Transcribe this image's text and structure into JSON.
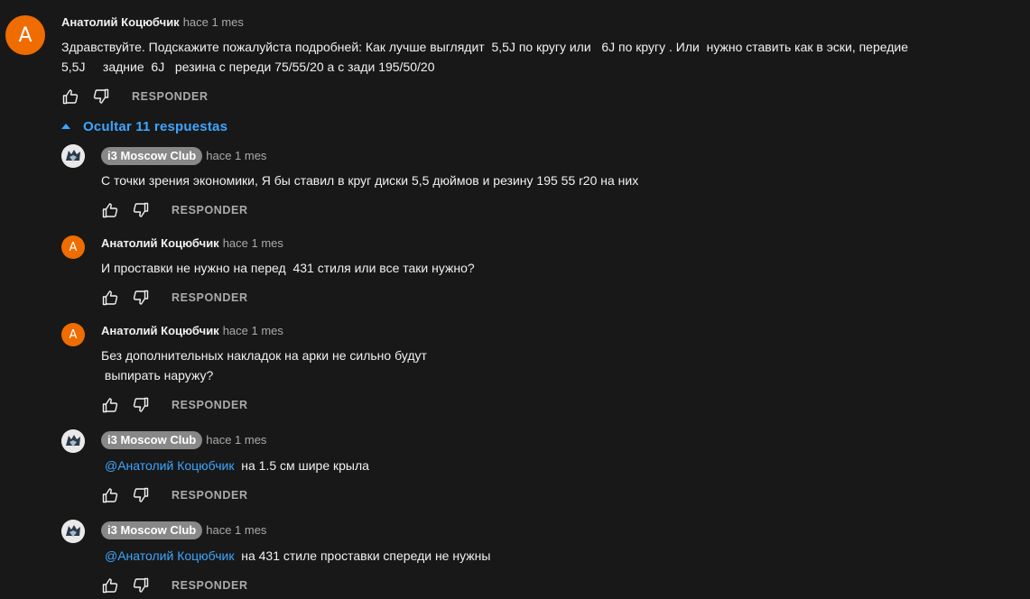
{
  "main_comment": {
    "avatar_letter": "A",
    "author": "Анатолий Коцюбчик",
    "time": "hace 1 mes",
    "text_line1": "Здравствуйте. Подскажите пожалуйста подробней: Как лучше выглядит  5,5J по кругу или   6J по кругу . Или  нужно ставить как в эски, передие",
    "text_line2": "5,5J     задние  6J   резина с переди 75/55/20 а с зади 195/50/20",
    "reply_label": "RESPONDER"
  },
  "replies_toggle": {
    "label": "Ocultar 11 respuestas"
  },
  "replies": [
    {
      "author": "i3 Moscow Club",
      "time": "hace 1 mes",
      "mention": "",
      "text": "С точки зрения экономики, Я бы ставил в круг диски 5,5 дюймов и резину 195 55 r20 на них",
      "reply_label": "RESPONDER"
    },
    {
      "avatar_letter": "A",
      "author": "Анатолий Коцюбчик",
      "time": "hace 1 mes",
      "text": "И проставки не нужно на перед  431 стиля или все таки нужно?",
      "reply_label": "RESPONDER"
    },
    {
      "avatar_letter": "A",
      "author": "Анатолий Коцюбчик",
      "time": "hace 1 mes",
      "text_line1": "Без дополнительных накладок на арки не сильно будут",
      "text_line2": " выпирать наружу?",
      "reply_label": "RESPONDER"
    },
    {
      "author": "i3 Moscow Club",
      "time": "hace 1 mes",
      "mention": "@Анатолий Коцюбчик",
      "text": "  на 1.5 см шире крыла",
      "reply_label": "RESPONDER"
    },
    {
      "author": "i3 Moscow Club",
      "time": "hace 1 mes",
      "mention": "@Анатолий Коцюбчик",
      "text": "  на 431 стиле проставки спереди не нужны",
      "reply_label": "RESPONDER"
    }
  ],
  "icons": {
    "like": "thumbs-up-icon",
    "dislike": "thumbs-down-icon",
    "collapse": "caret-up-icon"
  }
}
